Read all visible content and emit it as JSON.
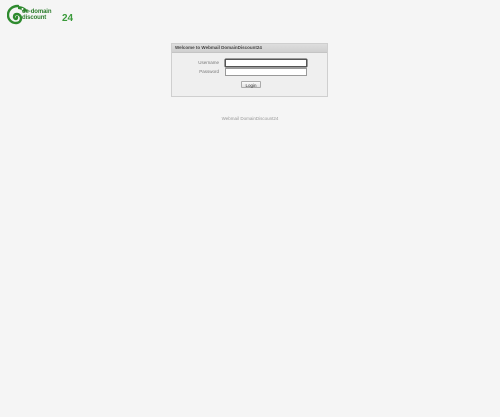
{
  "logo": {
    "line1": "de-domain",
    "line2": "discount",
    "number": "24",
    "icon": "chameleon-icon",
    "colors": {
      "primary": "#2e7d2e",
      "accent": "#3a9a3a"
    }
  },
  "login_panel": {
    "title": "Welcome to Webmail DomainDiscount24",
    "username_label": "Username",
    "username_value": "",
    "password_label": "Password",
    "password_value": "",
    "submit_label": "Login"
  },
  "footer": {
    "text": "Webmail DomainDiscount24"
  }
}
